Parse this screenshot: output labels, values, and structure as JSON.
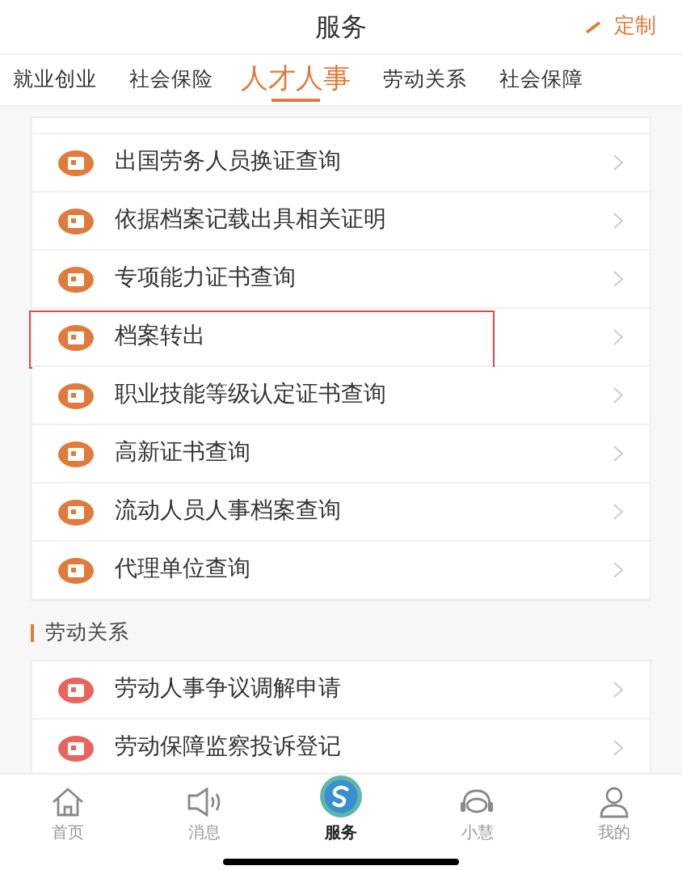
{
  "header": {
    "title": "服务",
    "action": "定制"
  },
  "tabs": [
    {
      "label": "就业创业",
      "selected": false
    },
    {
      "label": "社会保险",
      "selected": false
    },
    {
      "label": "人才人事",
      "selected": true
    },
    {
      "label": "劳动关系",
      "selected": false
    },
    {
      "label": "社会保障",
      "selected": false
    }
  ],
  "sections": [
    {
      "items": [
        {
          "label": "出国劳务人员换证查询",
          "color": "#e07b3c",
          "highlighted": false
        },
        {
          "label": "依据档案记载出具相关证明",
          "color": "#e07b3c",
          "highlighted": false
        },
        {
          "label": "专项能力证书查询",
          "color": "#e07b3c",
          "highlighted": false
        },
        {
          "label": "档案转出",
          "color": "#e07b3c",
          "highlighted": true
        },
        {
          "label": "职业技能等级认定证书查询",
          "color": "#e07b3c",
          "highlighted": false
        },
        {
          "label": "高新证书查询",
          "color": "#e07b3c",
          "highlighted": false
        },
        {
          "label": "流动人员人事档案查询",
          "color": "#e07b3c",
          "highlighted": false
        },
        {
          "label": "代理单位查询",
          "color": "#e07b3c",
          "highlighted": false
        }
      ]
    },
    {
      "title": "劳动关系",
      "items": [
        {
          "label": "劳动人事争议调解申请",
          "color": "#e8645e",
          "highlighted": false
        },
        {
          "label": "劳动保障监察投诉登记",
          "color": "#e8645e",
          "highlighted": false
        }
      ]
    }
  ],
  "nav": [
    {
      "label": "首页",
      "kind": "home",
      "selected": false
    },
    {
      "label": "消息",
      "kind": "speaker",
      "selected": false
    },
    {
      "label": "服务",
      "kind": "logo",
      "selected": true
    },
    {
      "label": "小慧",
      "kind": "headset",
      "selected": false
    },
    {
      "label": "我的",
      "kind": "person",
      "selected": false
    }
  ]
}
